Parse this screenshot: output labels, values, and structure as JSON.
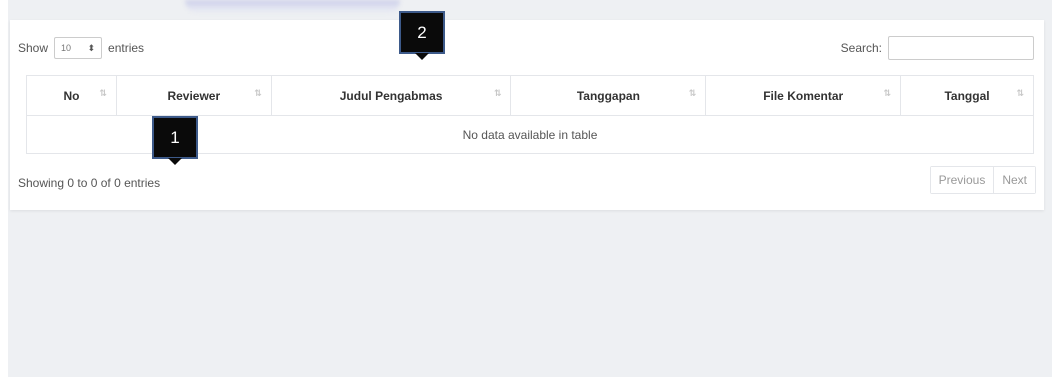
{
  "length_menu": {
    "show_label": "Show",
    "selected": "10",
    "entries_label": "entries"
  },
  "search": {
    "label": "Search:",
    "value": ""
  },
  "table": {
    "columns": [
      "No",
      "Reviewer",
      "Judul Pengabmas",
      "Tanggapan",
      "File Komentar",
      "Tanggal"
    ],
    "sort_icon": "⇅",
    "empty_message": "No data available in table"
  },
  "info": "Showing 0 to 0 of 0 entries",
  "pagination": {
    "previous": "Previous",
    "next": "Next"
  },
  "markers": [
    "1",
    "2"
  ]
}
